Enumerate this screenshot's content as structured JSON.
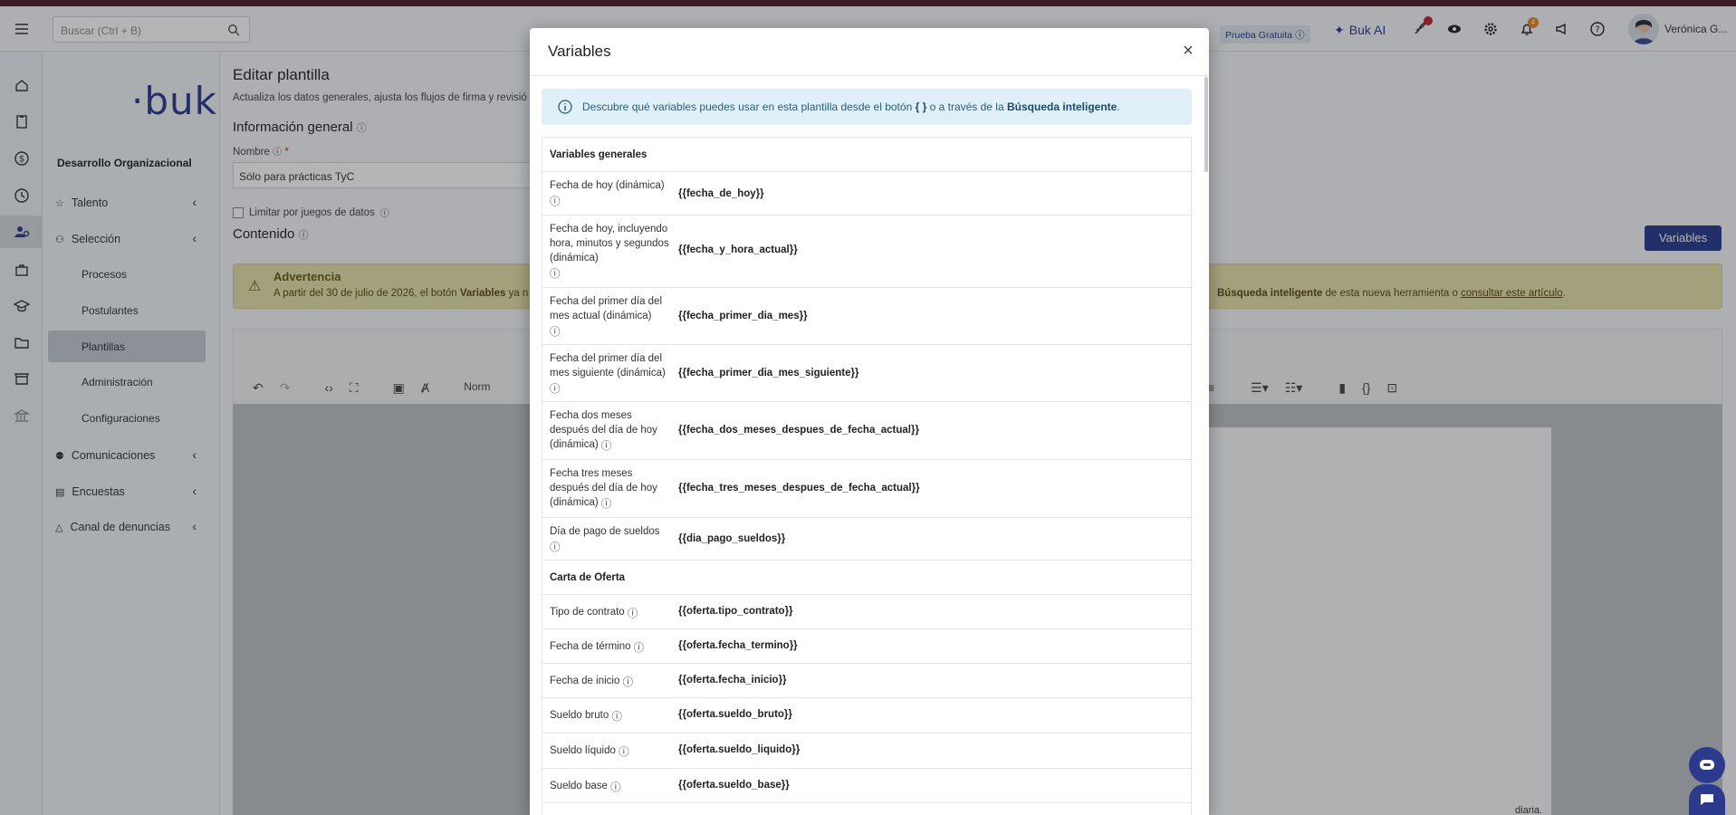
{
  "topbar": {
    "search_placeholder": "Buscar (Ctrl + B)",
    "trial_badge": "Prueba Gratuita",
    "ai_label": "Buk AI",
    "notif_count": "4",
    "user_name": "Verónica G..."
  },
  "sidebar": {
    "logo": "·buk·",
    "section": "Desarrollo Organizacional",
    "items": [
      {
        "label": "Talento"
      },
      {
        "label": "Selección"
      },
      {
        "label": "Comunicaciones"
      },
      {
        "label": "Encuestas"
      },
      {
        "label": "Canal de denuncias"
      }
    ],
    "subitems": [
      {
        "label": "Procesos"
      },
      {
        "label": "Postulantes"
      },
      {
        "label": "Plantillas"
      },
      {
        "label": "Administración"
      },
      {
        "label": "Configuraciones"
      }
    ]
  },
  "main": {
    "title": "Editar plantilla",
    "subtitle": "Actualiza los datos generales, ajusta los flujos de firma y revisió",
    "general_info": "Información general",
    "name_label": "Nombre",
    "required": "*",
    "name_value": "Sólo para prácticas TyC",
    "limit_label": "Limitar por juegos de datos",
    "content_label": "Contenido",
    "variables_button": "Variables",
    "warning_title": "Advertencia",
    "warning_text_start": "A partir del 30 de julio de 2026, el botón ",
    "warning_bold": "Variables",
    "warning_text_mid": " ya n",
    "warning_right_bold": "Búsqueda inteligente",
    "warning_right_text": " de esta nueva herramienta o ",
    "warning_link": "consultar este artículo",
    "warning_end": ".",
    "toolbar_style": "Norm",
    "bottom_text": "diaria."
  },
  "modal": {
    "title": "Variables",
    "info_start": "Descubre qué variables puedes usar en esta plantilla desde el botón ",
    "info_braces": "{ }",
    "info_mid": " o a través de la ",
    "info_bold": "Búsqueda inteligente",
    "info_end": ".",
    "section_general": "Variables generales",
    "general_vars": [
      {
        "label": "Fecha de hoy (dinámica)",
        "var": "{{fecha_de_hoy}}"
      },
      {
        "label": "Fecha de hoy, incluyendo hora, minutos y segundos (dinámica)",
        "var": "{{fecha_y_hora_actual}}"
      },
      {
        "label": "Fecha del primer día del mes actual (dinámica)",
        "var": "{{fecha_primer_dia_mes}}"
      },
      {
        "label": "Fecha del primer día del mes siguiente (dinámica)",
        "var": "{{fecha_primer_dia_mes_siguiente}}"
      },
      {
        "label": "Fecha dos meses después del día de hoy (dinámica)",
        "var": "{{fecha_dos_meses_despues_de_fecha_actual}}"
      },
      {
        "label": "Fecha tres meses después del día de hoy (dinámica)",
        "var": "{{fecha_tres_meses_despues_de_fecha_actual}}"
      },
      {
        "label": "Día de pago de sueldos",
        "var": "{{dia_pago_sueldos}}"
      }
    ],
    "section_offer": "Carta de Oferta",
    "offer_vars": [
      {
        "label": "Tipo de contrato",
        "var": "{{oferta.tipo_contrato}}"
      },
      {
        "label": "Fecha de término",
        "var": "{{oferta.fecha_termino}}"
      },
      {
        "label": "Fecha de inicio",
        "var": "{{oferta.fecha_inicio}}"
      },
      {
        "label": "Sueldo bruto",
        "var": "{{oferta.sueldo_bruto}}"
      },
      {
        "label": "Sueldo líquido",
        "var": "{{oferta.sueldo_liquido}}"
      },
      {
        "label": "Sueldo base",
        "var": "{{oferta.sueldo_base}}"
      }
    ]
  },
  "colors": {
    "brand": "#2b3a8c",
    "warning_bg": "#e8e0a8",
    "info_bg": "#dff0f8"
  }
}
